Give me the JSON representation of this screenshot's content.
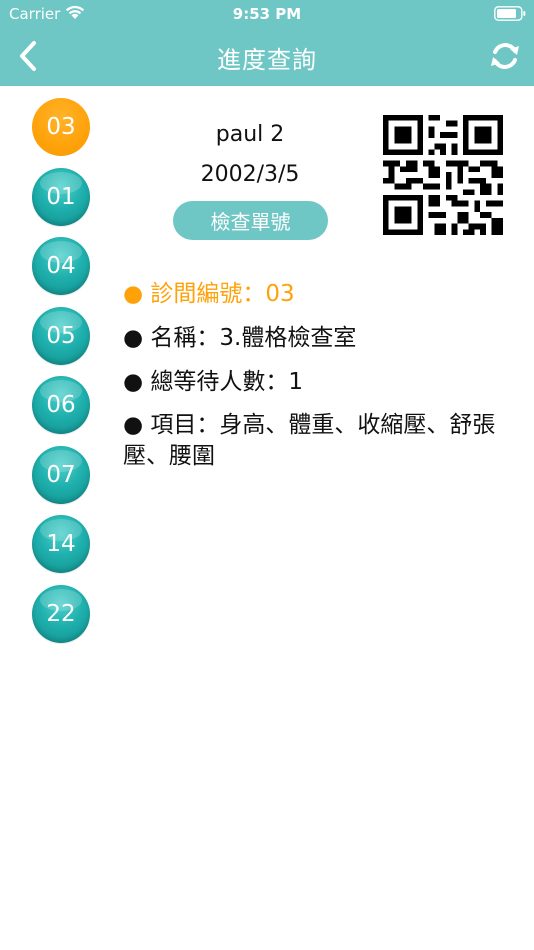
{
  "status_bar": {
    "carrier": "Carrier",
    "time": "9:53 PM"
  },
  "nav": {
    "title": "進度查詢",
    "back_icon": "chevron-left-icon",
    "refresh_icon": "refresh-icon"
  },
  "rooms": [
    "03",
    "01",
    "04",
    "05",
    "06",
    "07",
    "14",
    "22"
  ],
  "active_room": "03",
  "patient": {
    "name": "paul 2",
    "dob": "2002/3/5",
    "check_button": "檢查單號"
  },
  "info": {
    "room_number": "● 診間編號：03",
    "name": "● 名稱：3.體格檢查室",
    "waiting": "● 總等待人數：1",
    "items": "● 項目：身高、體重、收縮壓、舒張壓、腰圍"
  },
  "colors": {
    "accent": "#6ec6c5",
    "active": "#ffa20a",
    "room_button": "#1fb0ad"
  }
}
